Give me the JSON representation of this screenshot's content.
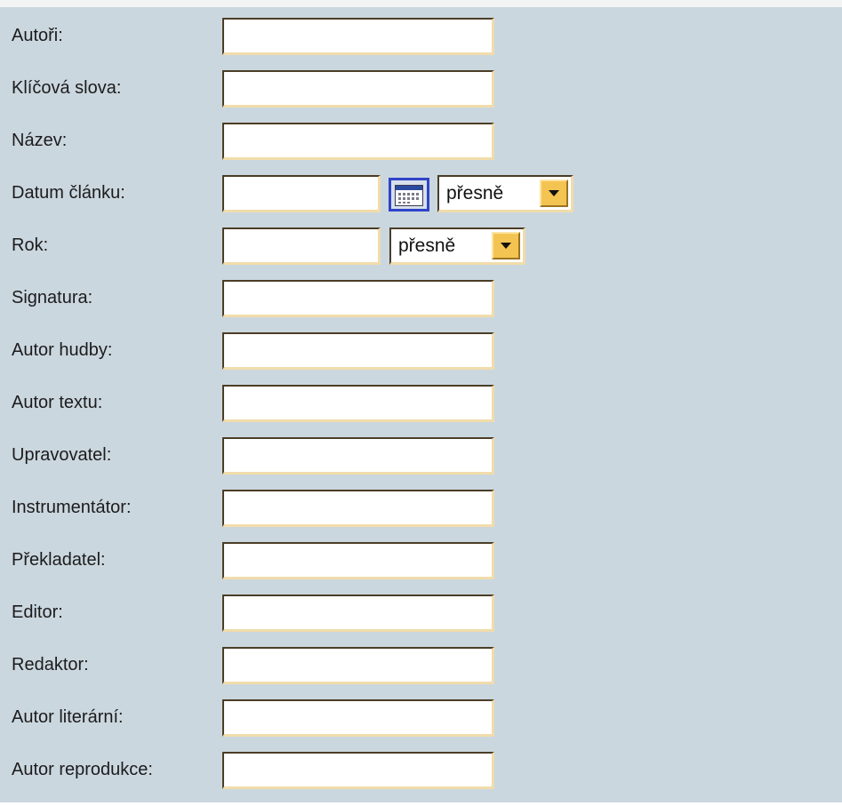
{
  "form": {
    "fields": [
      {
        "label": "Autoři:",
        "value": ""
      },
      {
        "label": "Klíčová slova:",
        "value": ""
      },
      {
        "label": "Název:",
        "value": ""
      },
      {
        "label": "Datum článku:",
        "value": "",
        "match_mode": "přesně",
        "calendar_icon": "calendar-icon"
      },
      {
        "label": "Rok:",
        "value": "",
        "match_mode": "přesně"
      },
      {
        "label": "Signatura:",
        "value": ""
      },
      {
        "label": "Autor hudby:",
        "value": ""
      },
      {
        "label": "Autor textu:",
        "value": ""
      },
      {
        "label": "Upravovatel:",
        "value": ""
      },
      {
        "label": "Instrumentátor:",
        "value": ""
      },
      {
        "label": "Překladatel:",
        "value": ""
      },
      {
        "label": "Editor:",
        "value": ""
      },
      {
        "label": "Redaktor:",
        "value": ""
      },
      {
        "label": "Autor literární:",
        "value": ""
      },
      {
        "label": "Autor reprodukce:",
        "value": ""
      }
    ]
  },
  "colors": {
    "panel_background": "#cbd7df",
    "input_border_dark": "#4b3d26",
    "input_border_light": "#f1dcab",
    "dropdown_button": "#f4c452",
    "calendar_border": "#2f44c8"
  }
}
